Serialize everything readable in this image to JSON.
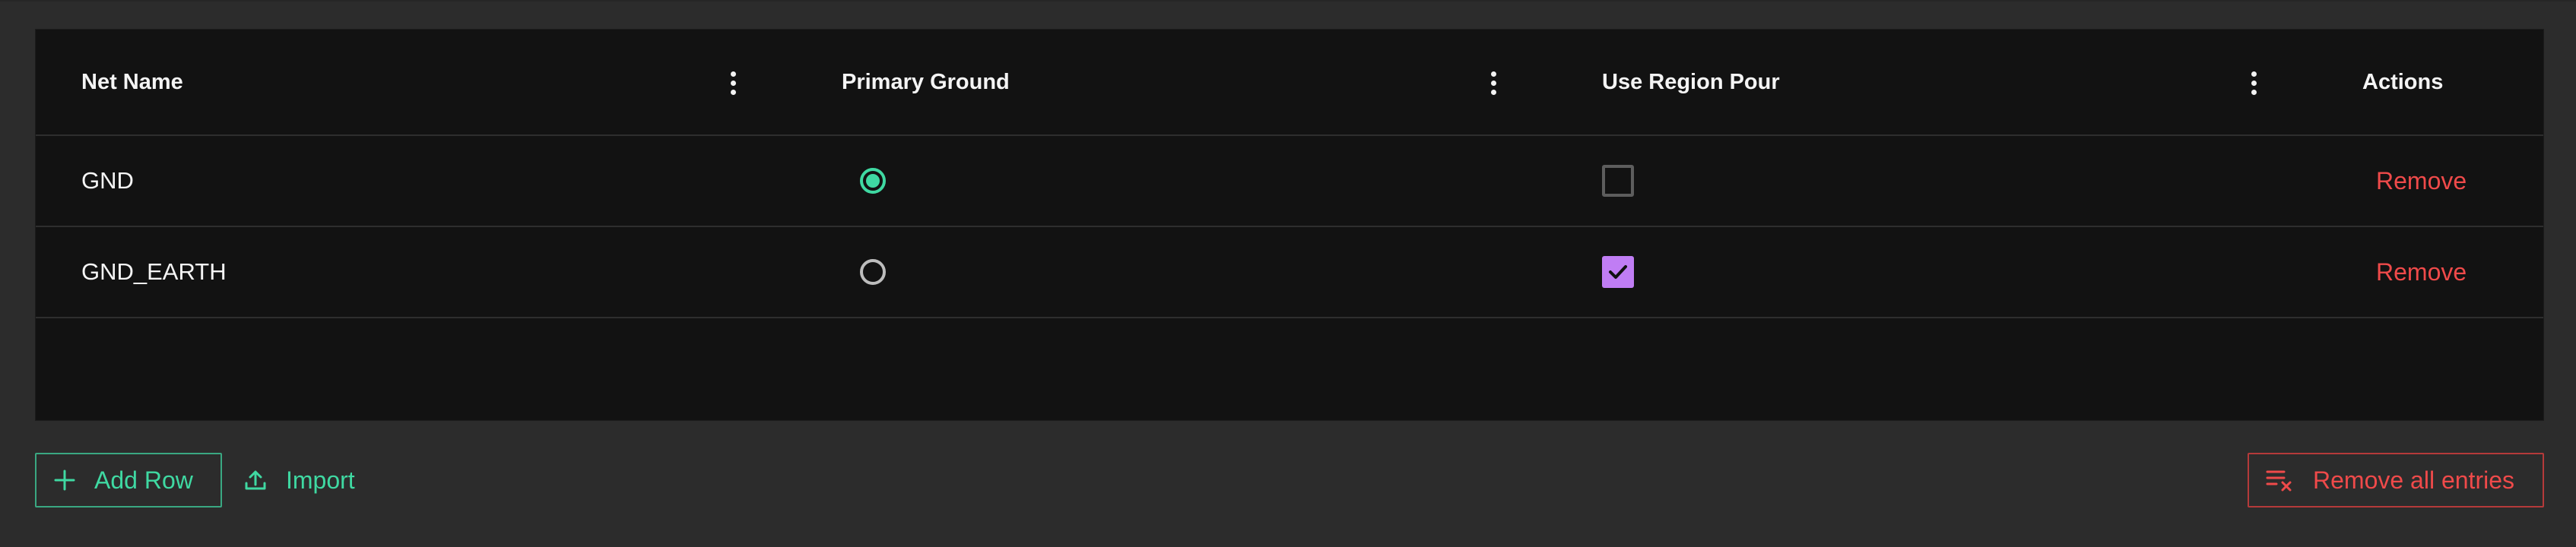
{
  "table": {
    "columns": [
      {
        "label": "Net Name"
      },
      {
        "label": "Primary Ground"
      },
      {
        "label": "Use Region Pour"
      },
      {
        "label": "Actions"
      }
    ],
    "rows": [
      {
        "net_name": "GND",
        "primary_ground": true,
        "use_region_pour": false,
        "action": "Remove"
      },
      {
        "net_name": "GND_EARTH",
        "primary_ground": false,
        "use_region_pour": true,
        "action": "Remove"
      }
    ]
  },
  "footer": {
    "add_row_label": "Add Row",
    "import_label": "Import",
    "remove_all_label": "Remove all entries"
  },
  "icons": {
    "column_menu": "kebab-menu-icon",
    "add": "plus-icon",
    "import": "upload-icon",
    "remove_all": "clear-list-icon"
  },
  "colors": {
    "accent": "#3fd9a2",
    "checkbox_checked": "#c07df4",
    "danger": "#ef4a4a",
    "grid_background": "#121212",
    "page_background": "#2c2c2c"
  }
}
